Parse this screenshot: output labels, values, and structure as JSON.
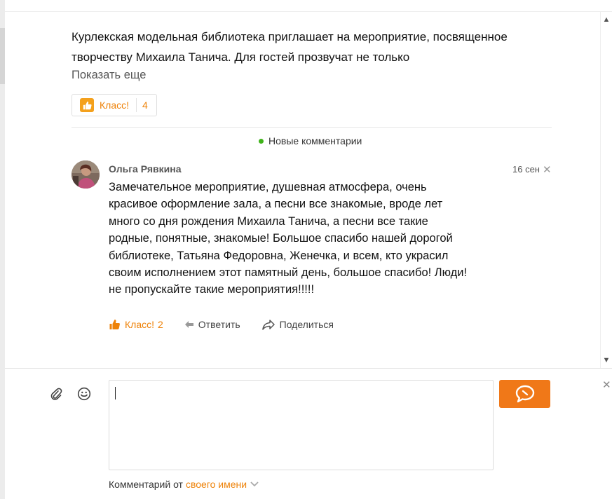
{
  "post": {
    "text": "Курлекская модельная библиотека приглашает на мероприятие, посвященное творчеству Михаила Танича.  Для гостей прозвучат не только",
    "show_more": "Показать еще",
    "like_label": "Класс!",
    "like_count": "4"
  },
  "comments_header": {
    "label": "Новые комментарии"
  },
  "comment": {
    "author": "Ольга Рявкина",
    "date": "16 сен",
    "close": "✕",
    "text": "Замечательное мероприятие, душевная атмосфера, очень красивое оформление зала, а песни все знакомые, вроде лет много со дня рождения Михаила Танича, а песни все такие родные, понятные, знакомые! Большое спасибо нашей дорогой библиотеке, Татьяна Федоровна, Женечка, и всем, кто украсил своим исполнением этот памятный день, большое спасибо! Люди! не пропускайте такие мероприятия!!!!!",
    "like_label": "Класс!",
    "like_count": "2",
    "reply_label": "Ответить",
    "share_label": "Поделиться"
  },
  "composer": {
    "placeholder": "",
    "close": "✕",
    "from_prefix": "Комментарий от",
    "from_link": "своего имени"
  },
  "colors": {
    "accent": "#ee8208",
    "send_button": "#f07818",
    "new_dot": "#3fb31a"
  },
  "icons": {
    "like": "thumbs-up-icon",
    "reply": "arrow-left-icon",
    "share": "share-arrow-icon",
    "attach": "paperclip-icon",
    "emoji": "smiley-icon",
    "send": "speech-bubble-icon"
  }
}
